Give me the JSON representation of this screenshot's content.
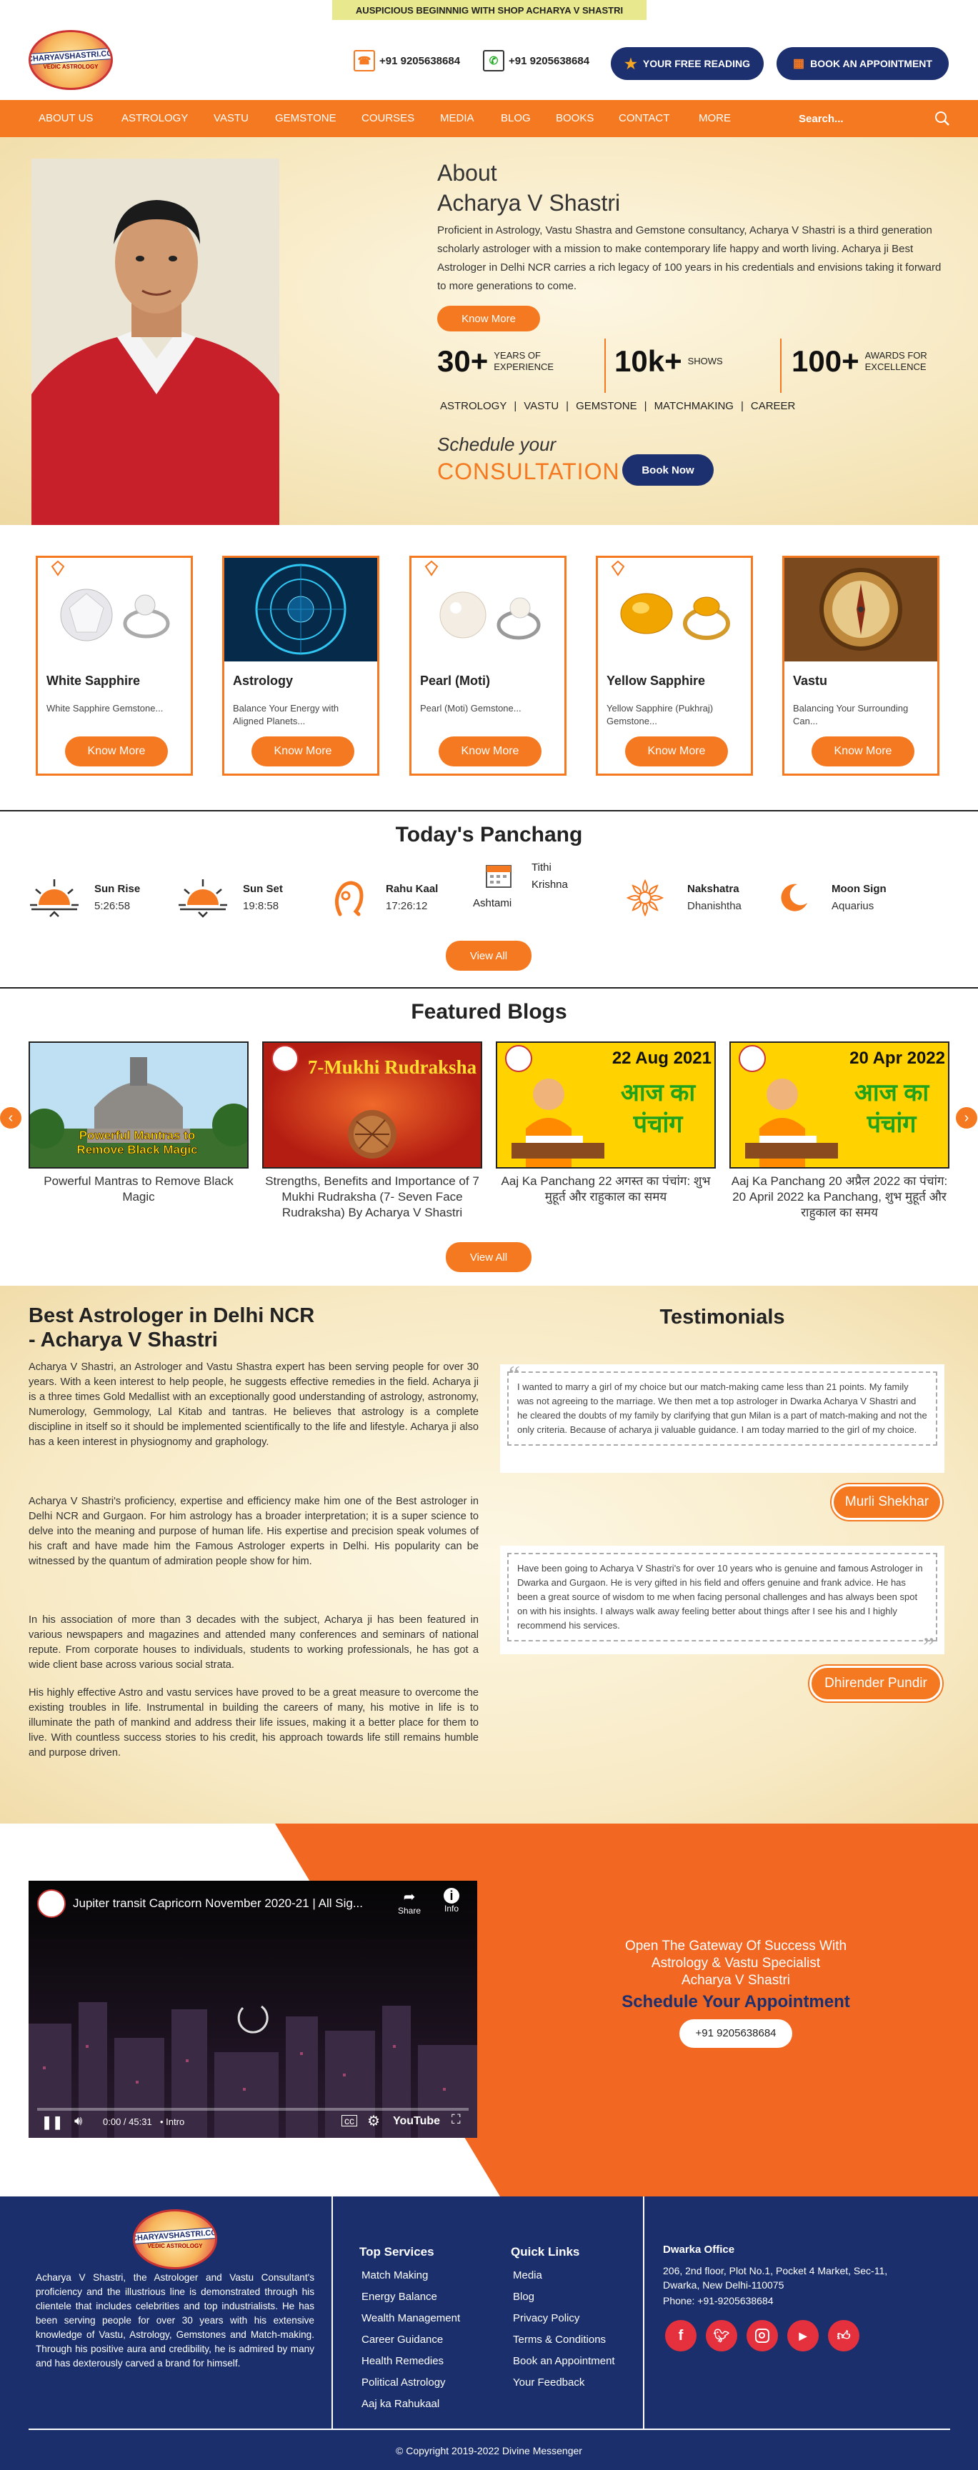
{
  "topbar": {
    "text": "AUSPICIOUS BEGINNNIG WITH SHOP ACHARYA V SHASTRI"
  },
  "brand": {
    "logo_text": "ACHARYAVSHASTRI.COM",
    "logo_sub": "VEDIC ASTROLOGY"
  },
  "header": {
    "phone_label": "+91 9205638684",
    "whatsapp_label": "+91 9205638684",
    "free_reading_label": "YOUR FREE READING",
    "appointment_label": "BOOK AN APPOINTMENT"
  },
  "nav": {
    "items": [
      "ABOUT US",
      "ASTROLOGY",
      "VASTU",
      "GEMSTONE",
      "COURSES",
      "MEDIA",
      "BLOG",
      "BOOKS",
      "CONTACT",
      "MORE"
    ],
    "search_placeholder": "Search..."
  },
  "about": {
    "heading": "About",
    "name": "Acharya V Shastri",
    "body": "Proficient in Astrology, Vastu Shastra and Gemstone consultancy, Acharya V Shastri is a third generation scholarly astrologer with a mission to make contemporary life happy and worth living. Acharya ji Best Astrologer in Delhi NCR carries a rich legacy of 100 years in his credentials and envisions taking it forward to more generations to come.",
    "know_more": "Know More",
    "stats": [
      {
        "num": "30+",
        "label1": "YEARS OF",
        "label2": "EXPERIENCE"
      },
      {
        "num": "10k+",
        "label1": "SHOWS",
        "label2": ""
      },
      {
        "num": "100+",
        "label1": "AWARDS FOR",
        "label2": "EXCELLENCE"
      }
    ],
    "tags": [
      "ASTROLOGY",
      "VASTU",
      "GEMSTONE",
      "MATCHMAKING",
      "CAREER"
    ],
    "schedule_line1": "Schedule your",
    "schedule_line2": "CONSULTATION",
    "book_now": "Book Now"
  },
  "cards": [
    {
      "title": "White Sapphire",
      "desc": "White Sapphire Gemstone...",
      "button": "Know More"
    },
    {
      "title": "Astrology",
      "desc": "Balance Your Energy with Aligned Planets...",
      "button": "Know More"
    },
    {
      "title": "Pearl (Moti)",
      "desc": "Pearl (Moti) Gemstone...",
      "button": "Know More"
    },
    {
      "title": "Yellow Sapphire",
      "desc": "Yellow Sapphire (Pukhraj) Gemstone...",
      "button": "Know More"
    },
    {
      "title": "Vastu",
      "desc": "Balancing Your Surrounding Can...",
      "button": "Know More"
    }
  ],
  "panchang": {
    "title": "Today's Panchang",
    "items": [
      {
        "label": "Sun Rise",
        "value": "5:26:58"
      },
      {
        "label": "Sun Set",
        "value": "19:8:58"
      },
      {
        "label": "Rahu Kaal",
        "value": "17:26:12"
      },
      {
        "label": "Tithi",
        "value": "Krishna",
        "extra": "Ashtami"
      },
      {
        "label": "Nakshatra",
        "value": "Dhanishtha"
      },
      {
        "label": "Moon Sign",
        "value": "Aquarius"
      }
    ],
    "view_all": "View All"
  },
  "blogs": {
    "title": "Featured Blogs",
    "items": [
      {
        "title": "Powerful Mantras to Remove Black Magic",
        "overlay": "Powerful Mantras to Remove Black Magic"
      },
      {
        "title": "Strengths, Benefits and Importance of 7 Mukhi Rudraksha (7- Seven Face Rudraksha) By Acharya V Shastri",
        "overlay": "7-Mukhi Rudraksha"
      },
      {
        "title": "Aaj Ka Panchang 22 अगस्त का पंचांग: शुभ मुहूर्त और राहुकाल का समय",
        "overlay": "22 Aug 2021",
        "overlay2": "आज का पंचांग"
      },
      {
        "title": "Aaj Ka Panchang 20 अप्रैल 2022 का पंचांग: 20 April 2022 ka Panchang, शुभ मुहूर्त और राहुकाल का समय",
        "overlay": "20 Apr 2022",
        "overlay2": "आज का पंचांग"
      }
    ],
    "view_all": "View All"
  },
  "best": {
    "title_line1": "Best Astrologer in Delhi NCR",
    "title_line2": "- Acharya V Shastri",
    "paragraphs": [
      "Acharya V Shastri, an Astrologer and Vastu Shastra expert has been serving people for over 30 years. With a keen interest to help people, he suggests effective remedies in the field. Acharya ji is a three times Gold Medallist with an exceptionally good understanding of astrology, astronomy, Numerology, Gemmology, Lal Kitab and tantras. He believes that astrology is a complete discipline in itself so it should be implemented scientifically to the life and lifestyle. Acharya ji also has a keen interest in physiognomy and graphology.",
      "Acharya V Shastri's proficiency, expertise and efficiency make him one of the Best astrologer in Delhi NCR and Gurgaon. For him astrology has a broader interpretation; it is a super science to delve into the meaning and purpose of human life. His expertise and precision speak volumes of his craft and have made him the Famous Astrologer experts in Delhi. His popularity can be witnessed by the quantum of admiration people show for him.",
      "In his association of more than 3 decades with the subject, Acharya ji has been featured in various newspapers and magazines and attended many conferences and seminars of national repute. From corporate houses to individuals, students to working professionals, he has got a wide client base across various social strata.",
      "His highly effective Astro and vastu services have proved to be a great measure to overcome the existing troubles in life. Instrumental in building the careers of many, his motive in life is to illuminate the path of mankind and address their life issues, making it a better place for them to live. With countless success stories to his credit, his approach towards life still remains humble and purpose driven."
    ]
  },
  "testimonials": {
    "title": "Testimonials",
    "items": [
      {
        "text": "I wanted to marry a girl of my choice but our match-making came less than 21 points. My family was not agreeing to the marriage. We then met a top astrologer in Dwarka Acharya V Shastri  and he cleared the doubts of my family by clarifying that gun Milan is a part of match-making and not the only criteria. Because of acharya ji valuable guidance. I am today married to the girl of my choice.",
        "name": "Murli Shekhar"
      },
      {
        "text": "Have been going to Acharya V Shastri's for over 10 years who is genuine and famous Astrologer in Dwarka and Gurgaon. He is very gifted in his field and offers genuine and frank advice. He has been a great source of wisdom to me when facing personal challenges and has always been spot on with his insights. I always walk away feeling better about things after I see his and I highly recommend his services.",
        "name": "Dhirender Pundir"
      }
    ]
  },
  "video": {
    "title": "Jupiter transit Capricorn November 2020-21 | All Sig...",
    "share": "Share",
    "info": "Info",
    "time": "0:00 / 45:31",
    "chapter": "Intro",
    "brand": "YouTube"
  },
  "cta": {
    "line1": "Open The Gateway Of Success With",
    "line2": "Astrology & Vastu Specialist",
    "line3": "Acharya V Shastri",
    "heading": "Schedule Your Appointment",
    "phone": "+91 9205638684"
  },
  "footer": {
    "about": "Acharya V Shastri, the Astrologer and Vastu Consultant's proficiency and the illustrious line is demonstrated through his clientele that includes celebrities and top industrialists. He has been serving people for over 30 years with his extensive knowledge of Vastu, Astrology, Gemstones and Match-making. Through his positive aura and credibility, he is admired by many and has dexterously carved a brand for himself.",
    "services_title": "Top Services",
    "services": [
      "Match Making",
      "Energy Balance",
      "Wealth Management",
      "Career Guidance",
      "Health Remedies",
      "Political Astrology",
      "Aaj ka Rahukaal"
    ],
    "links_title": "Quick Links",
    "links": [
      "Media",
      "Blog",
      "Privacy Policy",
      "Terms & Conditions",
      "Book an Appointment",
      "Your Feedback"
    ],
    "office_title": "Dwarka Office",
    "office_line1": "206, 2nd floor, Plot No.1, Pocket 4 Market, Sec-11,",
    "office_line2": "Dwarka, New Delhi-110075",
    "office_phone": "Phone: +91-9205638684",
    "copyright": "© Copyright 2019-2022 Divine Messenger"
  },
  "colors": {
    "orange": "#f47920",
    "navy": "#1c2f6e",
    "footer": "#1a2f6c",
    "red": "#e5313e"
  }
}
